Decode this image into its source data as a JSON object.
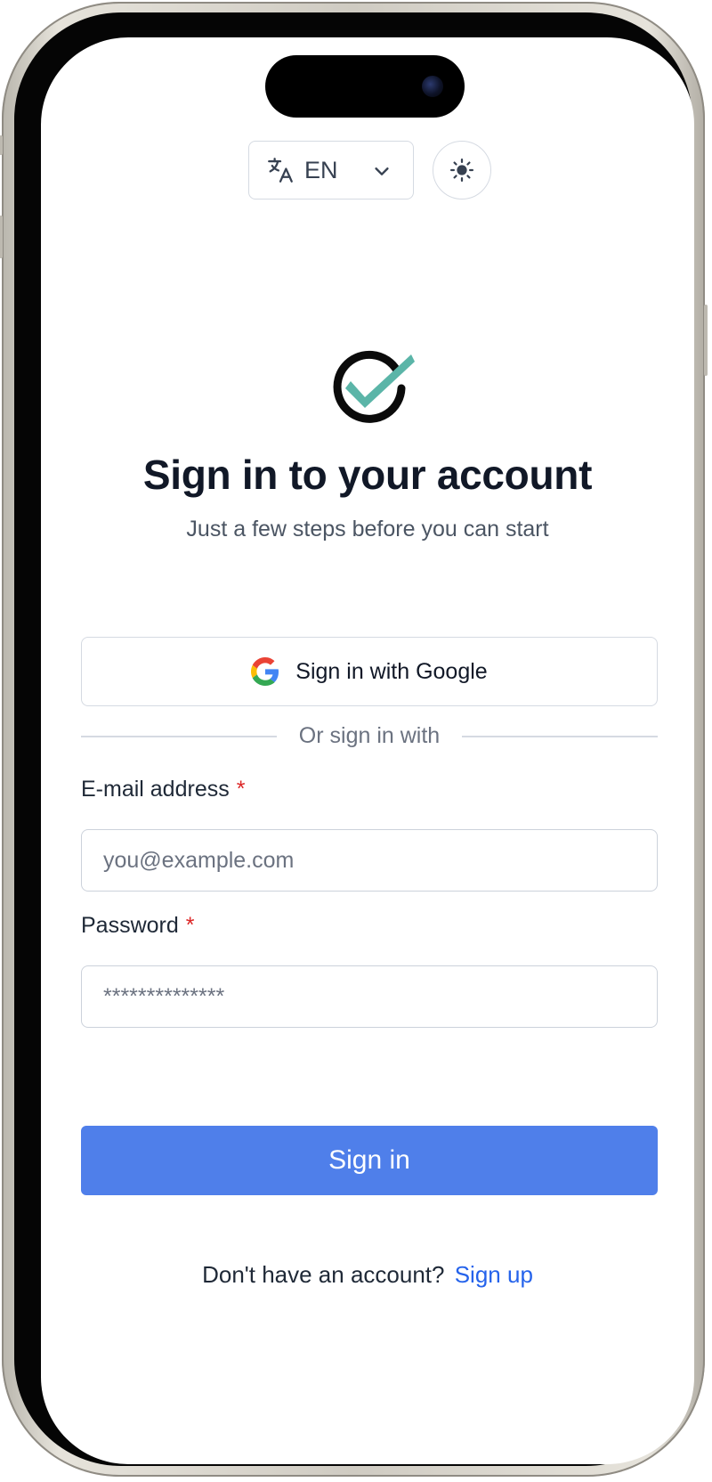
{
  "language": {
    "code": "EN",
    "icon": "translate-icon",
    "dropdown_icon": "chevron-down-icon"
  },
  "theme_toggle": {
    "icon": "sun-icon"
  },
  "logo": {
    "icon": "check-circle-logo",
    "accent": "#5bb5a8"
  },
  "header": {
    "title": "Sign in to your account",
    "subtitle": "Just a few steps before you can start"
  },
  "google": {
    "label": "Sign in with Google",
    "icon": "google-icon"
  },
  "divider": {
    "text": "Or sign in with"
  },
  "form": {
    "email": {
      "label": "E-mail address",
      "required_mark": "*",
      "placeholder": "you@example.com",
      "value": ""
    },
    "password": {
      "label": "Password",
      "required_mark": "*",
      "placeholder": "**************",
      "value": ""
    },
    "submit_label": "Sign in"
  },
  "footer": {
    "prompt": "Don't have an account?",
    "link_label": "Sign up"
  },
  "colors": {
    "primary": "#4f7fea",
    "link": "#2563eb",
    "required": "#dc2626",
    "title": "#111827"
  }
}
